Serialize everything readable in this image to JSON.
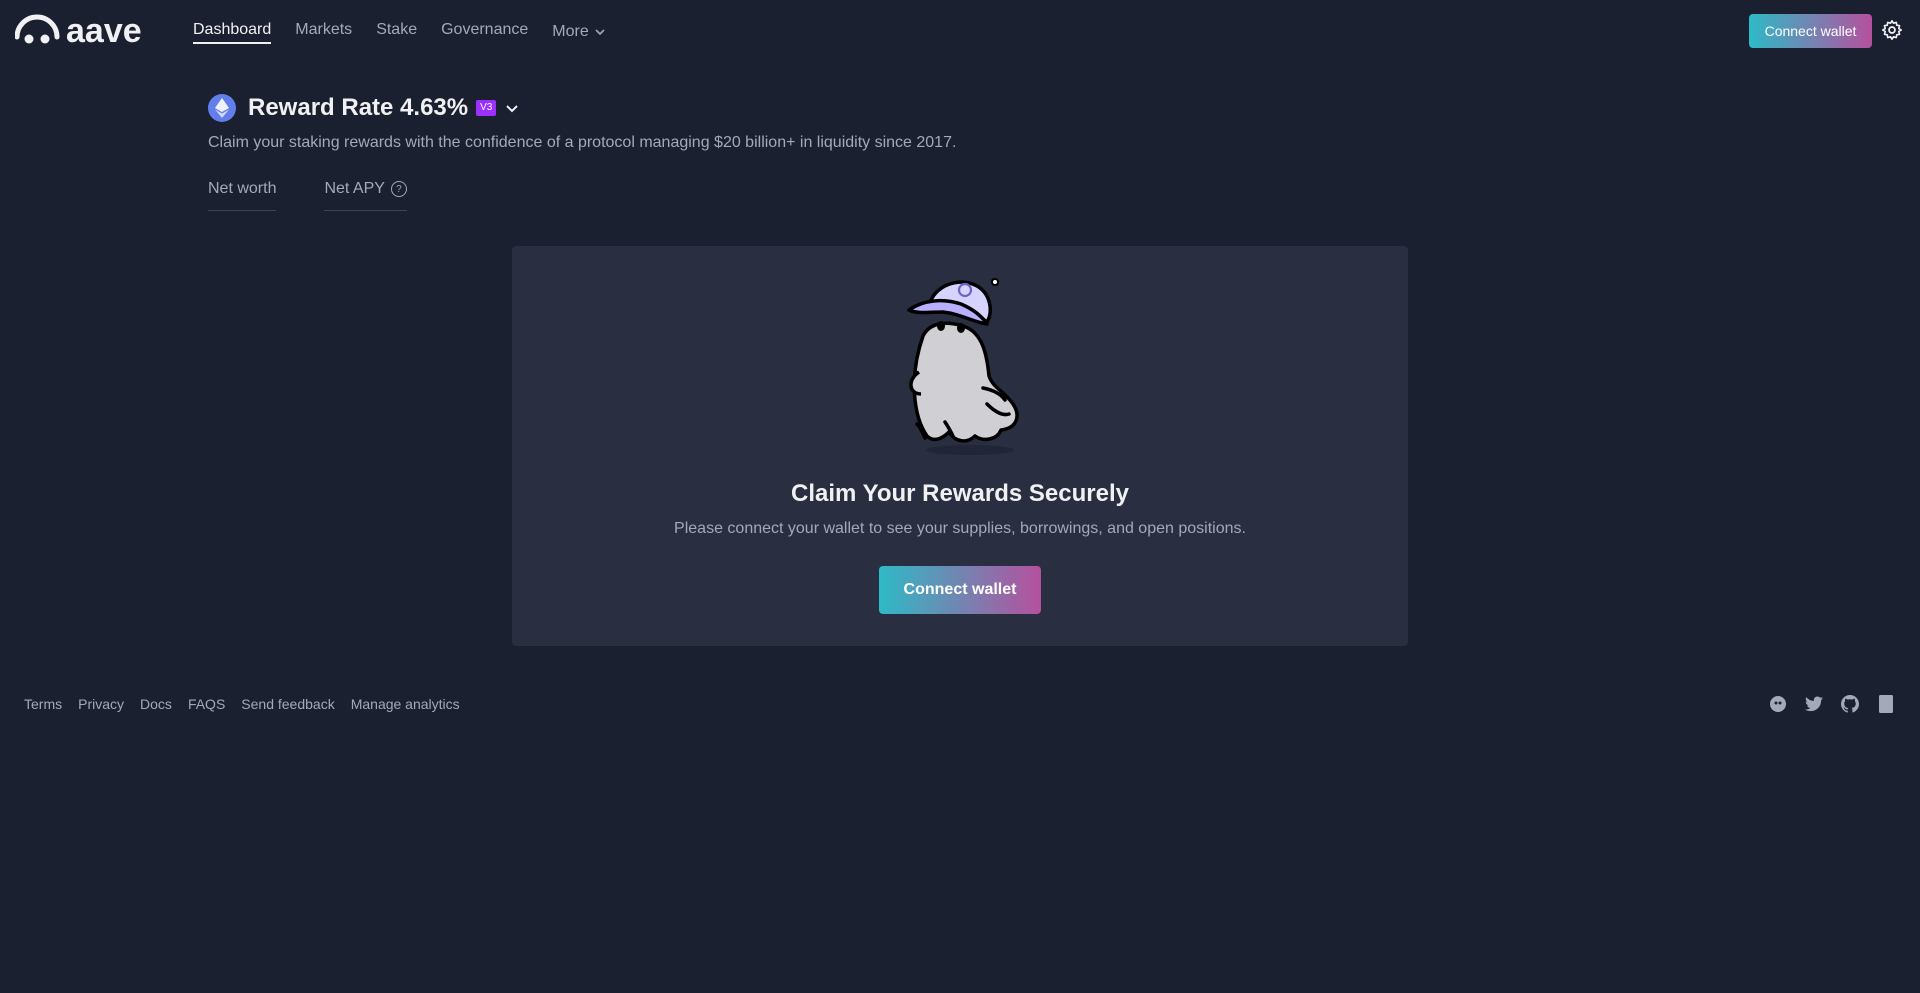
{
  "header": {
    "logo_text": "aave",
    "nav": [
      {
        "label": "Dashboard",
        "active": true
      },
      {
        "label": "Markets",
        "active": false
      },
      {
        "label": "Stake",
        "active": false
      },
      {
        "label": "Governance",
        "active": false
      }
    ],
    "more_label": "More",
    "connect_label": "Connect wallet"
  },
  "market": {
    "icon": "ethereum-icon",
    "title": "Reward Rate 4.63%",
    "version_badge": "V3",
    "subtitle": "Claim your staking rewards with the confidence of a protocol managing $20 billion+ in liquidity since 2017."
  },
  "stats": {
    "net_worth_label": "Net worth",
    "net_apy_label": "Net APY",
    "help_glyph": "?"
  },
  "card": {
    "illustration": "ghost-with-cap-illustration",
    "title": "Claim Your Rewards Securely",
    "description": "Please connect your wallet to see your supplies, borrowings, and open positions.",
    "button_label": "Connect wallet"
  },
  "footer": {
    "links": [
      "Terms",
      "Privacy",
      "Docs",
      "FAQS",
      "Send feedback",
      "Manage analytics"
    ],
    "icons": [
      "lens-icon",
      "twitter-icon",
      "github-icon",
      "discord-icon"
    ]
  },
  "colors": {
    "background": "#1b2030",
    "card": "#292e41",
    "gradient_start": "#2ebac6",
    "gradient_end": "#b6509e",
    "badge": "#9b30ff",
    "text_primary": "#f1f1f3",
    "text_secondary": "#a5a8b6"
  }
}
